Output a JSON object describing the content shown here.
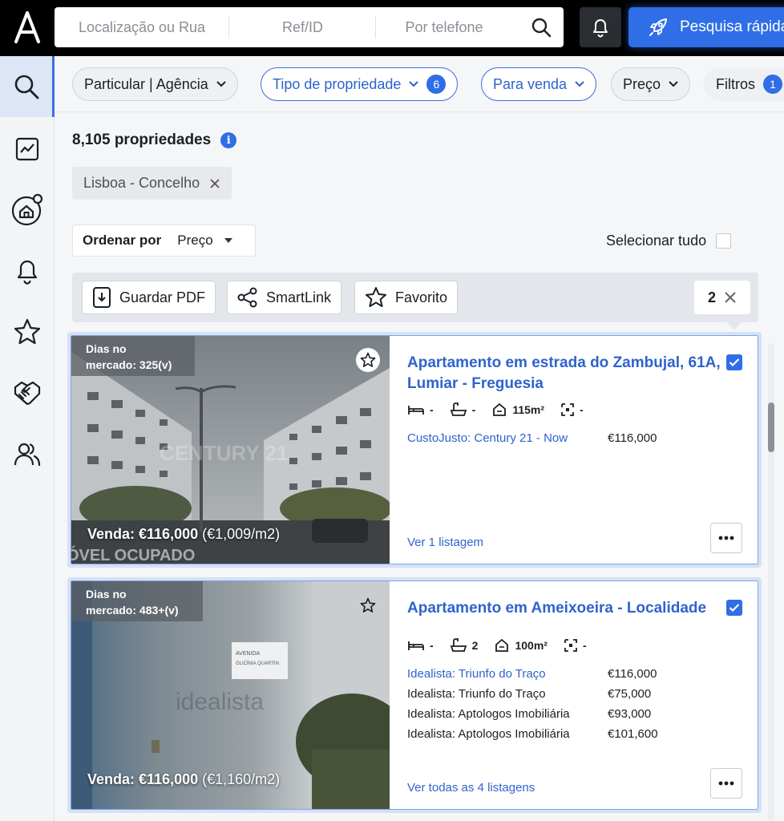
{
  "header": {
    "search": {
      "location_placeholder": "Localização ou Rua",
      "ref_placeholder": "Ref/ID",
      "phone_placeholder": "Por telefone"
    },
    "quick_search_label": "Pesquisa rápida",
    "colors": {
      "accent": "#2f6ee6",
      "bar": "#000000"
    }
  },
  "sidebar": {
    "items": [
      {
        "icon": "search-icon",
        "active": true
      },
      {
        "icon": "chart-icon"
      },
      {
        "icon": "home-search-icon"
      },
      {
        "icon": "bell-icon"
      },
      {
        "icon": "star-icon"
      },
      {
        "icon": "handshake-icon"
      },
      {
        "icon": "users-icon"
      }
    ]
  },
  "filters": {
    "seller": "Particular | Agência",
    "property_type": "Tipo de propriedade",
    "property_type_count": "6",
    "sale": "Para venda",
    "price": "Preço",
    "more": "Filtros",
    "more_count": "1"
  },
  "results": {
    "count": "8,105 propriedades",
    "chip": "Lisboa - Concelho",
    "sort_label": "Ordenar por",
    "sort_value": "Preço",
    "select_all": "Selecionar tudo"
  },
  "actions": {
    "pdf": "Guardar PDF",
    "smartlink": "SmartLink",
    "favorite": "Favorito",
    "selected_count": "2"
  },
  "listings": [
    {
      "days_label": "Dias no",
      "days_value": "mercado: 325(v)",
      "sale_price": "Venda: €116,000",
      "price_per_m2": "(€1,009/m2)",
      "title": "Apartamento em estrada do Zambujal, 61A, Lumiar - Freguesia",
      "beds": "-",
      "baths": "-",
      "area": "115m²",
      "plot": "-",
      "rows": [
        {
          "source": "CustoJusto: Century 21 - Now",
          "price": "€116,000"
        }
      ],
      "view_link": "Ver 1 listagem"
    },
    {
      "days_label": "Dias no",
      "days_value": "mercado: 483+(v)",
      "sale_price": "Venda: €116,000",
      "price_per_m2": "(€1,160/m2)",
      "title": "Apartamento em Ameixoeira - Localidade",
      "beds": "-",
      "baths": "2",
      "area": "100m²",
      "plot": "-",
      "rows": [
        {
          "source": "Idealista: Triunfo do Traço",
          "price": "€116,000"
        },
        {
          "source": "Idealista: Triunfo do Traço",
          "price": "€75,000"
        },
        {
          "source": "Idealista: Aptologos Imobiliária",
          "price": "€93,000"
        },
        {
          "source": "Idealista: Aptologos Imobiliária",
          "price": "€101,600"
        }
      ],
      "view_link": "Ver todas as 4 listagens"
    }
  ]
}
